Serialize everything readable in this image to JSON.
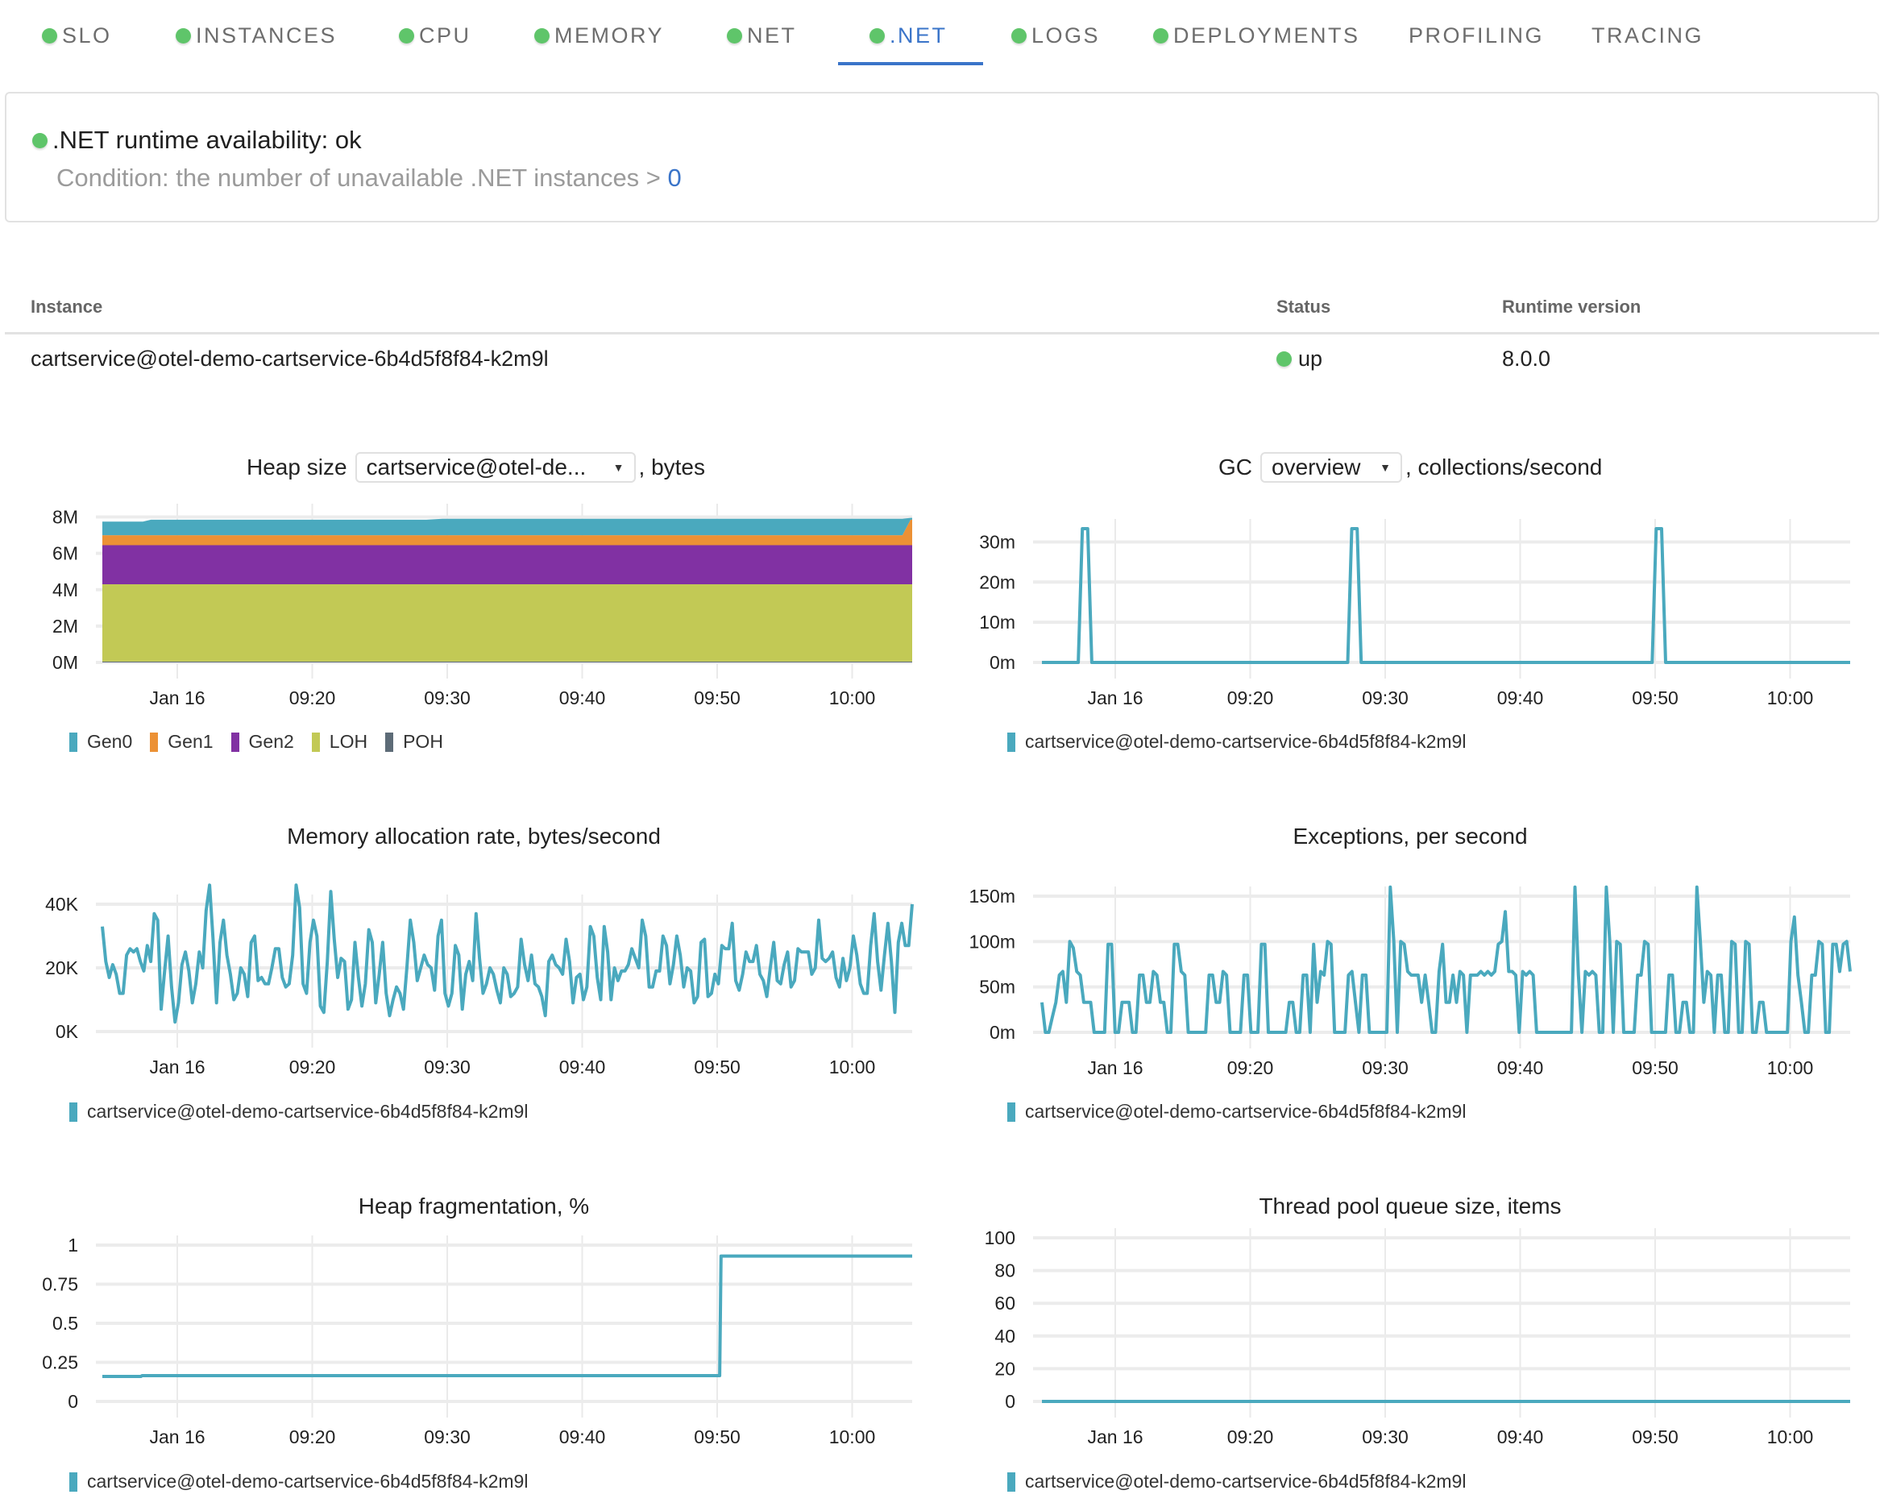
{
  "tabs": [
    {
      "label": "SLO",
      "status": "ok",
      "active": false
    },
    {
      "label": "INSTANCES",
      "status": "ok",
      "active": false
    },
    {
      "label": "CPU",
      "status": "ok",
      "active": false
    },
    {
      "label": "MEMORY",
      "status": "ok",
      "active": false
    },
    {
      "label": "NET",
      "status": "ok",
      "active": false
    },
    {
      "label": ".NET",
      "status": "ok",
      "active": true
    },
    {
      "label": "LOGS",
      "status": "ok",
      "active": false
    },
    {
      "label": "DEPLOYMENTS",
      "status": "ok",
      "active": false
    },
    {
      "label": "PROFILING",
      "status": null,
      "active": false
    },
    {
      "label": "TRACING",
      "status": null,
      "active": false
    }
  ],
  "alert": {
    "title": ".NET runtime availability: ok",
    "condition_prefix": "Condition: the number of unavailable .NET instances > ",
    "condition_value": "0"
  },
  "table": {
    "headers": {
      "instance": "Instance",
      "status": "Status",
      "runtime": "Runtime version"
    },
    "rows": [
      {
        "instance": "cartservice@otel-demo-cartservice-6b4d5f8f84-k2m9l",
        "status": "up",
        "runtime": "8.0.0"
      }
    ]
  },
  "colors": {
    "accent": "#3a74c9",
    "ok": "#5fc56a",
    "series": "#4aa9be",
    "gen0": "#4aa9be",
    "gen1": "#ec9135",
    "gen2": "#8131a3",
    "loh": "#c2c955",
    "poh": "#5d6b77",
    "grid": "#ececec"
  },
  "x_ticks": [
    "Jan 16",
    "09:20",
    "09:30",
    "09:40",
    "09:50",
    "10:00"
  ],
  "charts": {
    "heap": {
      "title_prefix": "Heap size",
      "select_value": "cartservice@otel-de...",
      "title_suffix": ", bytes"
    },
    "gc": {
      "title_prefix": "GC",
      "select_value": "overview",
      "title_suffix": ", collections/second"
    },
    "alloc": {
      "title": "Memory allocation rate, bytes/second"
    },
    "exceptions": {
      "title": "Exceptions, per second"
    },
    "frag": {
      "title": "Heap fragmentation, %"
    },
    "threadpool": {
      "title": "Thread pool queue size, items"
    }
  },
  "chart_data": [
    {
      "id": "heap",
      "type": "area",
      "title": "Heap size, bytes",
      "stacked": true,
      "x_range": [
        "09:14",
        "10:04"
      ],
      "x_ticks": [
        "Jan 16",
        "09:20",
        "09:30",
        "09:40",
        "09:50",
        "10:00"
      ],
      "y_ticks": [
        "0M",
        "2M",
        "4M",
        "6M",
        "8M"
      ],
      "ylim": [
        0,
        8.2
      ],
      "yunit": "M bytes",
      "legend": [
        "Gen0",
        "Gen1",
        "Gen2",
        "LOH",
        "POH"
      ],
      "legend_position": "bottom-left",
      "x": [
        0,
        2.5,
        3,
        20,
        21,
        49.4,
        49.9,
        50
      ],
      "series": [
        {
          "name": "POH",
          "values": [
            0.05,
            0.05,
            0.05,
            0.05,
            0.05,
            0.05,
            0.05,
            0.05
          ]
        },
        {
          "name": "LOH",
          "values": [
            4.25,
            4.25,
            4.25,
            4.25,
            4.25,
            4.25,
            4.25,
            4.25
          ]
        },
        {
          "name": "Gen2",
          "values": [
            2.15,
            2.15,
            2.15,
            2.15,
            2.15,
            2.15,
            2.15,
            2.15
          ]
        },
        {
          "name": "Gen1",
          "values": [
            0.55,
            0.55,
            0.55,
            0.55,
            0.55,
            0.55,
            1.4,
            1.4
          ]
        },
        {
          "name": "Gen0",
          "values": [
            0.75,
            0.75,
            0.85,
            0.85,
            0.9,
            0.9,
            0.1,
            0.1
          ]
        }
      ]
    },
    {
      "id": "gc",
      "type": "line",
      "title": "GC overview, collections/second",
      "x_ticks": [
        "Jan 16",
        "09:20",
        "09:30",
        "09:40",
        "09:50",
        "10:00"
      ],
      "y_ticks": [
        "0m",
        "10m",
        "20m",
        "30m"
      ],
      "ylim": [
        0,
        33
      ],
      "legend": [
        "cartservice@otel-demo-cartservice-6b4d5f8f84-k2m9l"
      ],
      "legend_position": "bottom-left",
      "x": [
        0,
        2.7,
        3.0,
        3.4,
        3.7,
        22.7,
        23.0,
        23.4,
        23.7,
        45.3,
        45.6,
        46.0,
        46.3,
        60
      ],
      "values": [
        0,
        0,
        33.3,
        33.3,
        0,
        0,
        33.3,
        33.3,
        0,
        0,
        33.3,
        33.3,
        0,
        0
      ]
    },
    {
      "id": "alloc",
      "type": "line",
      "title": "Memory allocation rate, bytes/second",
      "x_ticks": [
        "Jan 16",
        "09:20",
        "09:30",
        "09:40",
        "09:50",
        "10:00"
      ],
      "y_ticks": [
        "0K",
        "20K",
        "40K"
      ],
      "ylim": [
        -2,
        47
      ],
      "yunit": "K bytes/s",
      "legend": [
        "cartservice@otel-demo-cartservice-6b4d5f8f84-k2m9l"
      ],
      "legend_position": "bottom-left",
      "values": [
        33,
        22,
        17,
        21,
        18,
        12,
        12,
        24,
        26,
        25,
        26,
        22,
        19,
        27,
        22,
        37,
        35,
        7,
        19,
        30,
        14,
        3,
        9,
        21,
        25,
        19,
        9,
        15,
        25,
        20,
        38,
        46,
        29,
        9,
        28,
        35,
        24,
        18,
        10,
        12,
        20,
        18,
        11,
        28,
        30,
        16,
        17,
        15,
        15,
        20,
        26,
        26,
        17,
        14,
        15,
        24,
        46,
        39,
        15,
        12,
        28,
        35,
        30,
        8,
        6,
        22,
        44,
        29,
        17,
        23,
        22,
        7,
        10,
        28,
        17,
        8,
        15,
        32,
        28,
        9,
        18,
        28,
        12,
        5,
        10,
        14,
        12,
        7,
        20,
        35,
        28,
        16,
        20,
        24,
        21,
        20,
        13,
        30,
        35,
        12,
        8,
        12,
        27,
        24,
        7,
        18,
        22,
        16,
        37,
        23,
        12,
        15,
        20,
        18,
        13,
        9,
        20,
        18,
        11,
        12,
        14,
        29,
        21,
        16,
        24,
        15,
        14,
        11,
        5,
        22,
        24,
        21,
        20,
        18,
        29,
        22,
        9,
        17,
        18,
        10,
        14,
        33,
        30,
        17,
        10,
        33,
        25,
        10,
        20,
        16,
        19,
        19,
        21,
        26,
        23,
        20,
        35,
        30,
        14,
        14,
        19,
        19,
        30,
        27,
        15,
        21,
        30,
        24,
        14,
        20,
        19,
        9,
        11,
        28,
        29,
        11,
        12,
        18,
        15,
        27,
        26,
        26,
        34,
        16,
        13,
        18,
        25,
        22,
        22,
        27,
        18,
        16,
        11,
        20,
        28,
        16,
        15,
        21,
        25,
        14,
        16,
        26,
        25,
        25,
        25,
        18,
        20,
        35,
        23,
        22,
        23,
        25,
        17,
        14,
        23,
        16,
        20,
        30,
        24,
        15,
        12,
        12,
        27,
        37,
        22,
        13,
        24,
        34,
        22,
        6,
        28,
        34,
        27,
        27,
        40
      ]
    },
    {
      "id": "exceptions",
      "type": "line",
      "title": "Exceptions, per second",
      "x_ticks": [
        "Jan 16",
        "09:20",
        "09:30",
        "09:40",
        "09:50",
        "10:00"
      ],
      "y_ticks": [
        "0m",
        "50m",
        "100m",
        "150m"
      ],
      "ylim": [
        -10,
        165
      ],
      "legend": [
        "cartservice@otel-demo-cartservice-6b4d5f8f84-k2m9l"
      ],
      "legend_position": "bottom-left",
      "values": [
        33,
        0,
        0,
        17,
        33,
        63,
        67,
        33,
        100,
        93,
        67,
        63,
        33,
        33,
        33,
        0,
        0,
        0,
        0,
        97,
        97,
        0,
        0,
        33,
        33,
        33,
        0,
        0,
        63,
        63,
        33,
        33,
        67,
        63,
        33,
        33,
        0,
        0,
        97,
        97,
        67,
        63,
        0,
        0,
        0,
        0,
        0,
        0,
        63,
        63,
        33,
        33,
        67,
        63,
        0,
        0,
        0,
        0,
        63,
        63,
        0,
        0,
        0,
        97,
        97,
        0,
        0,
        0,
        0,
        0,
        0,
        33,
        33,
        0,
        0,
        63,
        63,
        0,
        97,
        33,
        67,
        63,
        100,
        97,
        0,
        0,
        0,
        0,
        63,
        67,
        33,
        0,
        63,
        63,
        0,
        0,
        0,
        0,
        0,
        0,
        160,
        100,
        0,
        100,
        97,
        67,
        63,
        63,
        63,
        33,
        63,
        33,
        0,
        0,
        67,
        97,
        33,
        33,
        63,
        33,
        67,
        63,
        0,
        63,
        63,
        63,
        67,
        63,
        67,
        63,
        67,
        97,
        100,
        133,
        67,
        67,
        63,
        0,
        67,
        63,
        67,
        63,
        0,
        0,
        0,
        0,
        0,
        0,
        0,
        0,
        0,
        0,
        0,
        160,
        63,
        0,
        67,
        63,
        67,
        63,
        0,
        0,
        160,
        100,
        0,
        100,
        97,
        0,
        0,
        0,
        0,
        63,
        63,
        100,
        97,
        0,
        0,
        0,
        0,
        0,
        63,
        63,
        0,
        0,
        33,
        33,
        0,
        0,
        160,
        100,
        33,
        67,
        63,
        0,
        63,
        63,
        0,
        0,
        100,
        97,
        0,
        0,
        100,
        97,
        0,
        0,
        33,
        33,
        0,
        0,
        0,
        0,
        0,
        0,
        0,
        100,
        127,
        63,
        33,
        0,
        0,
        63,
        63,
        100,
        97,
        0,
        0,
        97,
        97,
        67,
        97,
        100,
        67
      ]
    },
    {
      "id": "frag",
      "type": "line",
      "title": "Heap fragmentation, %",
      "x_ticks": [
        "Jan 16",
        "09:20",
        "09:30",
        "09:40",
        "09:50",
        "10:00"
      ],
      "y_ticks": [
        "0",
        "0.25",
        "0.5",
        "0.75",
        "1"
      ],
      "ylim": [
        0,
        1
      ],
      "legend": [
        "cartservice@otel-demo-cartservice-6b4d5f8f84-k2m9l"
      ],
      "legend_position": "bottom-left",
      "x": [
        0,
        2.9,
        3.0,
        46.5,
        46.6,
        61
      ],
      "values": [
        0.16,
        0.16,
        0.165,
        0.165,
        0.93,
        0.93
      ]
    },
    {
      "id": "threadpool",
      "type": "line",
      "title": "Thread pool queue size, items",
      "x_ticks": [
        "Jan 16",
        "09:20",
        "09:30",
        "09:40",
        "09:50",
        "10:00"
      ],
      "y_ticks": [
        "0",
        "20",
        "40",
        "60",
        "80",
        "100"
      ],
      "ylim": [
        0,
        100
      ],
      "legend": [
        "cartservice@otel-demo-cartservice-6b4d5f8f84-k2m9l"
      ],
      "legend_position": "bottom-left",
      "x": [
        0,
        60
      ],
      "values": [
        0,
        0
      ]
    }
  ]
}
